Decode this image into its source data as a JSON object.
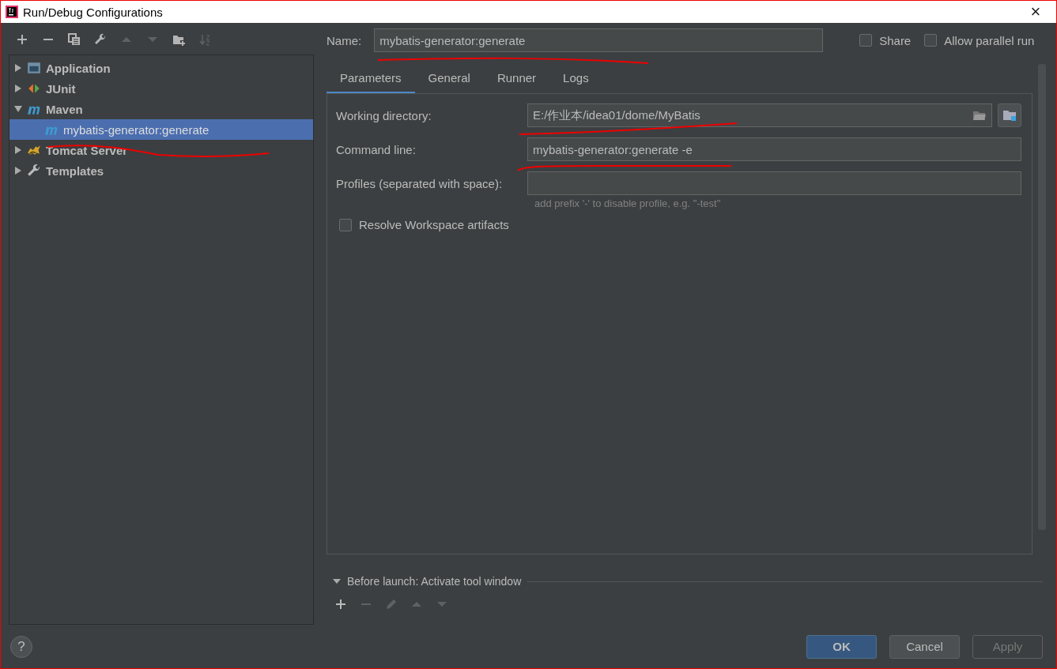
{
  "window": {
    "title": "Run/Debug Configurations",
    "close_label": "×"
  },
  "toolbar": [
    {
      "kind": "add",
      "disabled": false
    },
    {
      "kind": "remove",
      "disabled": false
    },
    {
      "kind": "copy",
      "disabled": false
    },
    {
      "kind": "wrench",
      "disabled": false
    },
    {
      "kind": "up",
      "disabled": true
    },
    {
      "kind": "down",
      "disabled": true
    },
    {
      "kind": "folder-add",
      "disabled": false
    },
    {
      "kind": "sort",
      "disabled": true
    }
  ],
  "tree": [
    {
      "label": "Application",
      "kind": "application",
      "expanded": false,
      "selected": false
    },
    {
      "label": "JUnit",
      "kind": "junit",
      "expanded": false,
      "selected": false
    },
    {
      "label": "Maven",
      "kind": "maven",
      "expanded": true,
      "selected": false,
      "children": [
        {
          "label": "mybatis-generator:generate",
          "kind": "maven",
          "selected": true
        }
      ]
    },
    {
      "label": "Tomcat Server",
      "kind": "tomcat",
      "expanded": false,
      "selected": false
    },
    {
      "label": "Templates",
      "kind": "wrench",
      "expanded": false,
      "selected": false
    }
  ],
  "name_field": {
    "label": "Name:",
    "value": "mybatis-generator:generate"
  },
  "options": [
    {
      "label": "Share",
      "checked": false
    },
    {
      "label": "Allow parallel run",
      "checked": false
    }
  ],
  "tabs": [
    {
      "label": "Parameters",
      "selected": true
    },
    {
      "label": "General",
      "selected": false
    },
    {
      "label": "Runner",
      "selected": false
    },
    {
      "label": "Logs",
      "selected": false
    }
  ],
  "parameters": {
    "fields": [
      {
        "kind": "directory",
        "label": "Working directory:",
        "value": "E:/作业本/idea01/dome/MyBatis"
      },
      {
        "kind": "text",
        "label": "Command line:",
        "value": "mybatis-generator:generate -e"
      },
      {
        "kind": "text",
        "label": "Profiles (separated with space):",
        "hint": "add prefix '-' to disable profile, e.g. \"-test\""
      }
    ],
    "resolve_workspace": {
      "label": "Resolve Workspace artifacts",
      "checked": false
    }
  },
  "before_launch": {
    "label": "Before launch: Activate tool window",
    "expanded": true,
    "toolbar": [
      {
        "kind": "add",
        "disabled": false
      },
      {
        "kind": "remove",
        "disabled": true
      },
      {
        "kind": "pencil",
        "disabled": true
      },
      {
        "kind": "up",
        "disabled": true
      },
      {
        "kind": "down",
        "disabled": true
      }
    ]
  },
  "help_button": {
    "label": "?"
  },
  "buttons": [
    {
      "label": "OK",
      "kind": "default",
      "disabled": false
    },
    {
      "label": "Cancel",
      "kind": "normal",
      "disabled": false
    },
    {
      "label": "Apply",
      "kind": "normal",
      "disabled": true
    }
  ]
}
